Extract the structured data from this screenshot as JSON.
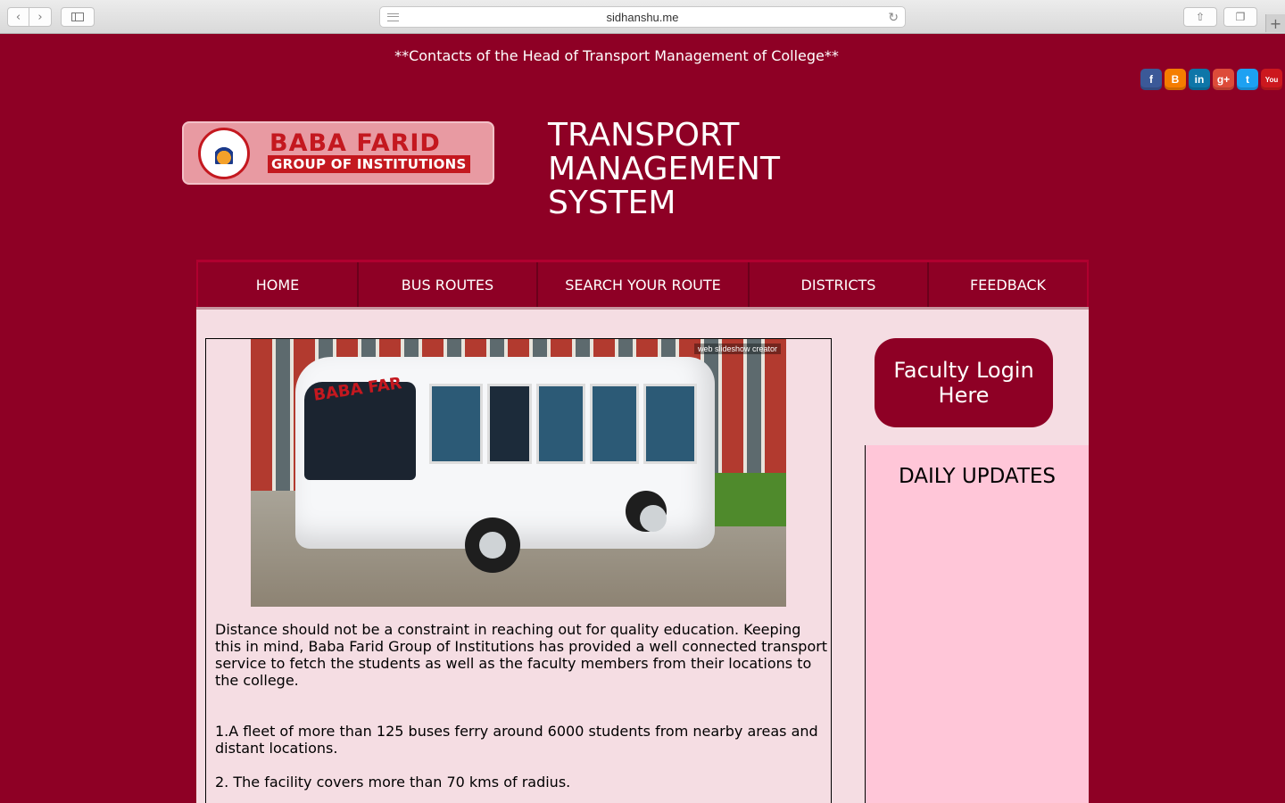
{
  "browser": {
    "url": "sidhanshu.me",
    "back_icon": "chevron-left-icon",
    "forward_icon": "chevron-right-icon"
  },
  "header": {
    "contacts_link": "**Contacts of the Head of Transport Management of College**",
    "social": [
      {
        "name": "facebook",
        "glyph": "f",
        "color": "#3b5998"
      },
      {
        "name": "blogger",
        "glyph": "B",
        "color": "#f57d00"
      },
      {
        "name": "linkedin",
        "glyph": "in",
        "color": "#0e76a8"
      },
      {
        "name": "google-plus",
        "glyph": "g+",
        "color": "#dd4b39"
      },
      {
        "name": "twitter",
        "glyph": "t",
        "color": "#1da1f2"
      },
      {
        "name": "youtube",
        "glyph": "You",
        "color": "#cc181e"
      }
    ],
    "logo_name": "BABA FARID",
    "logo_sub": "GROUP OF INSTITUTIONS",
    "site_title_lines": [
      "TRANSPORT",
      "MANAGEMENT",
      "SYSTEM"
    ]
  },
  "nav": [
    {
      "label": "HOME"
    },
    {
      "label": "BUS ROUTES"
    },
    {
      "label": "SEARCH YOUR ROUTE"
    },
    {
      "label": "DISTRICTS"
    },
    {
      "label": "FEEDBACK"
    }
  ],
  "main": {
    "slideshow_watermark": "web slideshow creator",
    "bus_brand": "BABA FAR",
    "paragraph1": "Distance should not be a constraint in reaching out for quality education. Keeping this in mind, Baba Farid Group of Institutions has provided a well connected transport service to fetch the students as well as the faculty members from their locations to the college.",
    "paragraph2": "1.A fleet of more than 125 buses ferry around 6000 students from nearby areas and distant locations.",
    "paragraph3": "2. The facility covers more than 70 kms of radius."
  },
  "sidebar": {
    "faculty_login": "Faculty Login Here",
    "updates_title": "DAILY UPDATES"
  },
  "colors": {
    "brand": "#8e0025",
    "content_bg": "#f5dde3",
    "updates_bg": "#ffc6d8"
  }
}
